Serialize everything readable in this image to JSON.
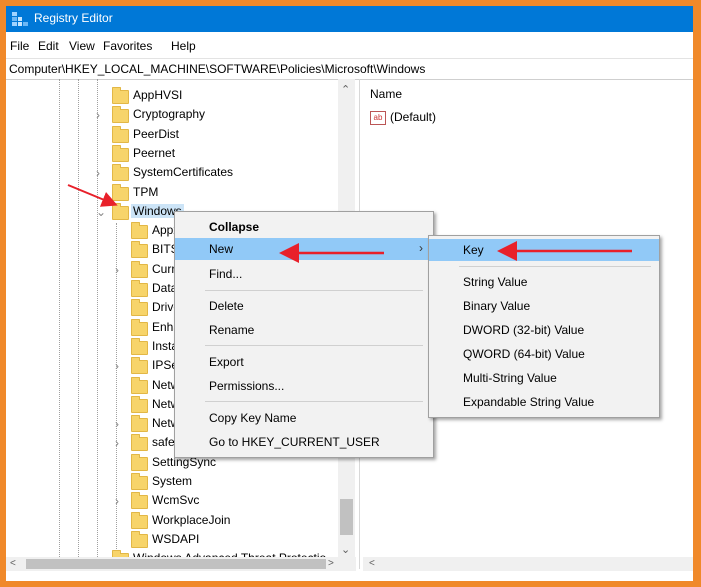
{
  "window": {
    "title": "Registry Editor"
  },
  "menu": [
    "File",
    "Edit",
    "View",
    "Favorites",
    "Help"
  ],
  "address": "Computer\\HKEY_LOCAL_MACHINE\\SOFTWARE\\Policies\\Microsoft\\Windows",
  "tree": {
    "parents": [
      {
        "label": "AppHVSI",
        "expandable": false
      },
      {
        "label": "Cryptography",
        "expandable": true
      },
      {
        "label": "PeerDist",
        "expandable": false
      },
      {
        "label": "Peernet",
        "expandable": false
      },
      {
        "label": "SystemCertificates",
        "expandable": true
      },
      {
        "label": "TPM",
        "expandable": false
      },
      {
        "label": "Windows",
        "expandable": true,
        "selected": true
      }
    ],
    "children": [
      {
        "label": "Appx",
        "expandable": false
      },
      {
        "label": "BITS",
        "expandable": false
      },
      {
        "label": "Curr",
        "expandable": true
      },
      {
        "label": "Data",
        "expandable": false
      },
      {
        "label": "Drive",
        "expandable": false
      },
      {
        "label": "Enha",
        "expandable": false
      },
      {
        "label": "Insta",
        "expandable": false
      },
      {
        "label": "IPSec",
        "expandable": true
      },
      {
        "label": "Netw",
        "expandable": false
      },
      {
        "label": "Netw",
        "expandable": false
      },
      {
        "label": "Netw",
        "expandable": true
      },
      {
        "label": "safer",
        "expandable": true
      },
      {
        "label": "SettingSync",
        "expandable": false
      },
      {
        "label": "System",
        "expandable": false
      },
      {
        "label": "WcmSvc",
        "expandable": true
      },
      {
        "label": "WorkplaceJoin",
        "expandable": false
      },
      {
        "label": "WSDAPI",
        "expandable": false
      }
    ],
    "last_partial": "Windows Advanced Threat Protectio"
  },
  "right_pane": {
    "column_name": "Name",
    "default_value": "(Default)",
    "value_icon_text": "ab"
  },
  "context_menu": {
    "items": [
      "Collapse",
      "New",
      "Find...",
      "Delete",
      "Rename",
      "Export",
      "Permissions...",
      "Copy Key Name",
      "Go to HKEY_CURRENT_USER"
    ],
    "highlighted": "New"
  },
  "submenu": {
    "items": [
      "Key",
      "String Value",
      "Binary Value",
      "DWORD (32-bit) Value",
      "QWORD (64-bit) Value",
      "Multi-String Value",
      "Expandable String Value"
    ],
    "highlighted": "Key"
  },
  "colors": {
    "border": "#f0892a",
    "titlebar": "#0078d7",
    "highlight": "#91c9f7",
    "annotation_arrow": "#e8202a"
  }
}
